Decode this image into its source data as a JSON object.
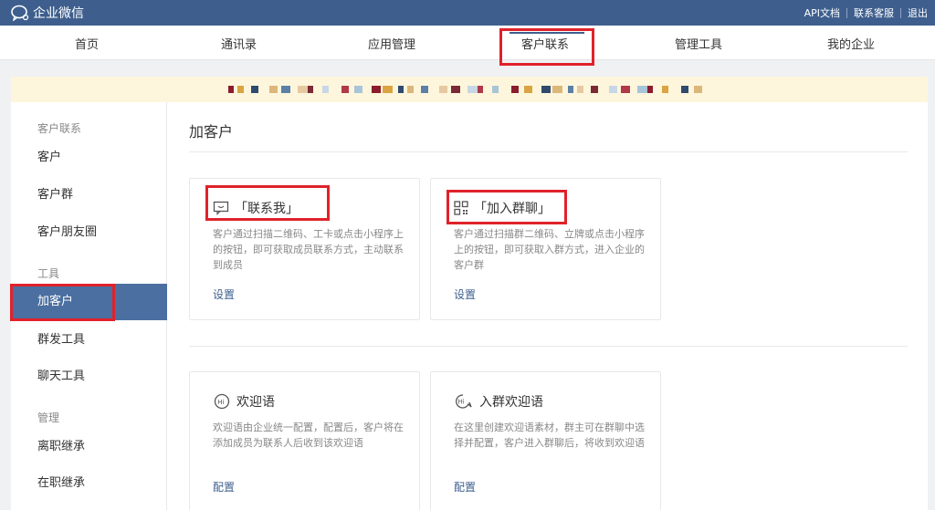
{
  "header": {
    "logo_text": "企业微信",
    "links": [
      "API文档",
      "联系客服",
      "退出"
    ]
  },
  "nav": {
    "items": [
      "首页",
      "通讯录",
      "应用管理",
      "客户联系",
      "管理工具",
      "我的企业"
    ],
    "active": "客户联系"
  },
  "sidebar": {
    "group1": "客户联系",
    "group1_items": [
      "客户",
      "客户群",
      "客户朋友圈"
    ],
    "group2": "工具",
    "group2_items": [
      "加客户",
      "群发工具",
      "聊天工具"
    ],
    "group3": "管理",
    "group3_items": [
      "离职继承",
      "在职继承"
    ],
    "active": "加客户"
  },
  "main": {
    "title": "加客户",
    "cards": [
      {
        "title": "「联系我」",
        "icon": "message-icon",
        "desc": "客户通过扫描二维码、工卡或点击小程序上的按钮，即可获取成员联系方式，主动联系到成员",
        "link": "设置"
      },
      {
        "title": "「加入群聊」",
        "icon": "qrcode-icon",
        "desc": "客户通过扫描群二维码、立牌或点击小程序上的按钮，即可获取入群方式，进入企业的客户群",
        "link": "设置"
      },
      {
        "title": "欢迎语",
        "icon": "hi-icon",
        "desc": "欢迎语由企业统一配置，配置后，客户将在添加成员为联系人后收到该欢迎语",
        "link": "配置"
      },
      {
        "title": "入群欢迎语",
        "icon": "hi-chat-icon",
        "desc": "在这里创建欢迎语素材，群主可在群聊中选择并配置，客户进入群聊后，将收到欢迎语",
        "link": "配置"
      }
    ]
  },
  "colors": {
    "header_bg": "#3e5f8e",
    "active_sidebar": "#4b6fa0",
    "highlight": "#e0222a",
    "banner_bg": "#fdf6dc"
  }
}
